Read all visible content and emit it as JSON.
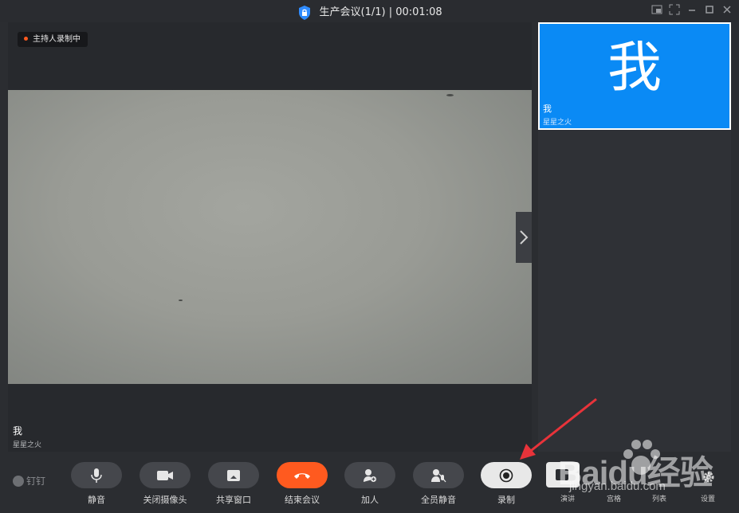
{
  "window": {
    "title": "生产会议(1/1) | 00:01:08",
    "controls": [
      "pip-icon",
      "fullscreen-icon",
      "minimize-icon",
      "maximize-icon",
      "close-icon"
    ]
  },
  "main_video": {
    "recording_badge": "主持人录制中",
    "participant_name": "我",
    "participant_subtitle": "星星之火"
  },
  "self_tile": {
    "big_char": "我",
    "name": "我",
    "subtitle": "星星之火",
    "color": "#0a8af5"
  },
  "toolbar": {
    "brand": "钉钉",
    "buttons": [
      {
        "label": "静音",
        "icon": "microphone-icon"
      },
      {
        "label": "关闭摄像头",
        "icon": "camera-icon"
      },
      {
        "label": "共享窗口",
        "icon": "share-window-icon"
      },
      {
        "label": "结束会议",
        "icon": "end-call-icon"
      },
      {
        "label": "加人",
        "icon": "add-person-icon"
      },
      {
        "label": "全员静音",
        "icon": "mute-all-icon"
      },
      {
        "label": "录制",
        "icon": "record-icon"
      }
    ],
    "small_buttons": [
      {
        "label": "演讲"
      },
      {
        "label": "宫格"
      },
      {
        "label": "列表"
      }
    ],
    "settings_label": "设置"
  },
  "watermark": {
    "text": "Baidu经验",
    "url_text": "jingyan.baidu.com"
  },
  "colors": {
    "accent_orange": "#ff5a1f",
    "self_tile_blue": "#0a8af5",
    "annotation_arrow": "#e8333a"
  }
}
